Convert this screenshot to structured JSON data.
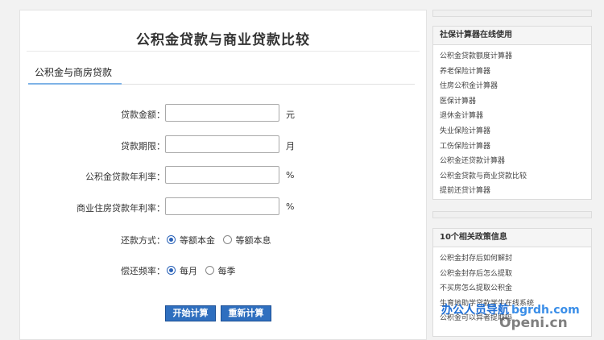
{
  "main": {
    "title": "公积金贷款与商业贷款比较",
    "tab": "公积金与商房贷款",
    "fields": [
      {
        "label": "贷款金额：",
        "unit": "元",
        "value": ""
      },
      {
        "label": "贷款期限：",
        "unit": "月",
        "value": ""
      },
      {
        "label": "公积金贷款年利率：",
        "unit": "%",
        "value": ""
      },
      {
        "label": "商业住房贷款年利率：",
        "unit": "%",
        "value": ""
      }
    ],
    "repayment_method": {
      "label": "还款方式：",
      "options": [
        "等额本金",
        "等额本息"
      ],
      "selected": "等额本金"
    },
    "repayment_frequency": {
      "label": "偿还频率：",
      "options": [
        "每月",
        "每季"
      ],
      "selected": "每月"
    },
    "buttons": {
      "calculate": "开始计算",
      "recalculate": "重新计算"
    }
  },
  "sidebar": {
    "calculators": {
      "title": "社保计算器在线使用",
      "items": [
        "公积金贷款额度计算器",
        "养老保险计算器",
        "住房公积金计算器",
        "医保计算器",
        "退休金计算器",
        "失业保险计算器",
        "工伤保险计算器",
        "公积金还贷款计算器",
        "公积金贷款与商业贷款比较",
        "提前还贷计算器"
      ]
    },
    "policies": {
      "title": "10个相关政策信息",
      "items": [
        "公积金封存后如何解封",
        "公积金封存后怎么提取",
        "不买房怎么提取公积金",
        "生育地助学贷款学生在线系统",
        "公积金可以异者提取吗"
      ]
    }
  },
  "watermark": {
    "line1": "办公人员导航",
    "line1_url": "bgrdh.com",
    "line2": "Openi.cn"
  },
  "colors": {
    "accent": "#2f6fbf",
    "tab_underline": "#7fb3e6",
    "watermark_blue": "#1f6fd6"
  }
}
